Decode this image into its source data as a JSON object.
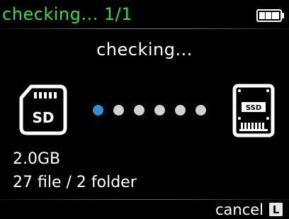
{
  "header": {
    "title": "checking... 1/1",
    "title_color": "#2ee03a",
    "battery_icon": "battery-full-icon"
  },
  "main": {
    "status": "checking...",
    "source_icon": "sd-card-icon",
    "source_label": "SD",
    "target_icon": "ssd-drive-icon",
    "target_label": "SSD",
    "progress": {
      "total_dots": 6,
      "active_index": 0,
      "active_color": "#2c93d6",
      "inactive_color": "#d2d2d2"
    },
    "size": "2.0GB",
    "counts": "27 file / 2 folder"
  },
  "footer": {
    "cancel_label": "cancel",
    "cancel_key": "L",
    "cancel_key_icon": "l-key-icon"
  }
}
